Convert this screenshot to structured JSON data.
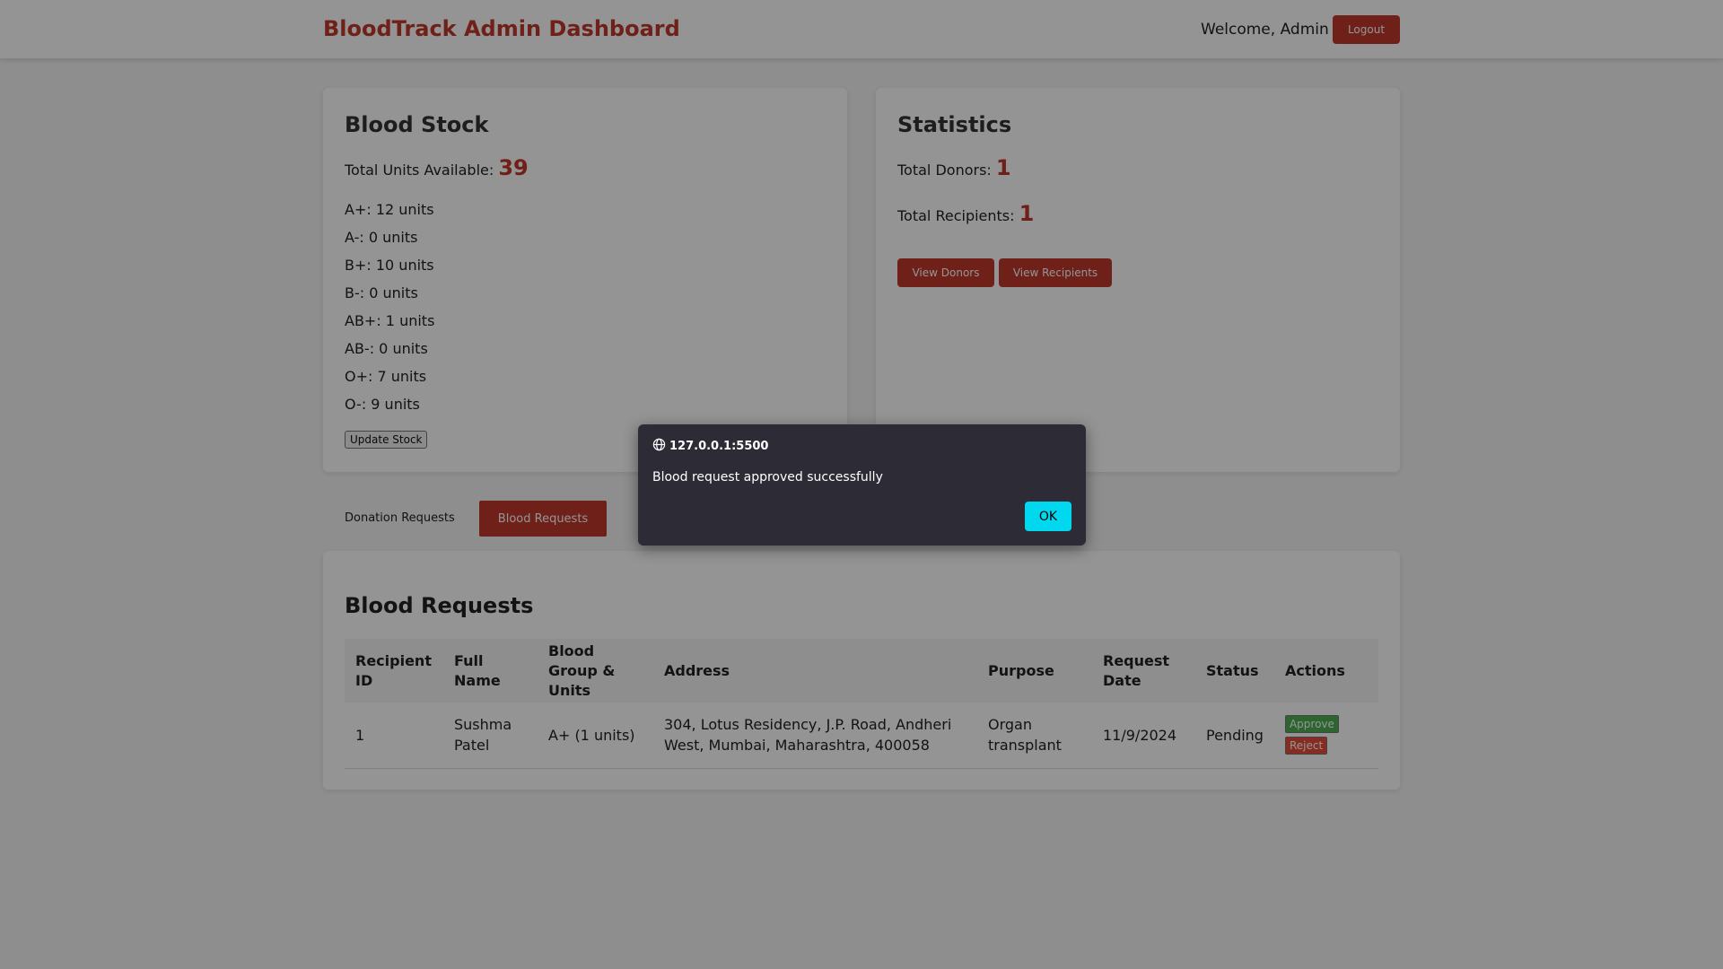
{
  "header": {
    "title": "BloodTrack Admin Dashboard",
    "welcome": "Welcome, Admin",
    "logout_label": "Logout"
  },
  "stock": {
    "heading": "Blood Stock",
    "total_label": "Total Units Available: ",
    "total_value": "39",
    "items": [
      "A+: 12 units",
      "A-: 0 units",
      "B+: 10 units",
      "B-: 0 units",
      "AB+: 1 units",
      "AB-: 0 units",
      "O+: 7 units",
      "O-: 9 units"
    ],
    "update_label": "Update Stock"
  },
  "stats": {
    "heading": "Statistics",
    "donors_label": "Total Donors: ",
    "donors_value": "1",
    "recipients_label": "Total Recipients: ",
    "recipients_value": "1",
    "view_donors_label": "View Donors",
    "view_recipients_label": "View Recipients"
  },
  "tabs": {
    "donation": "Donation Requests",
    "blood": "Blood Requests"
  },
  "requests": {
    "heading": "Blood Requests",
    "columns": [
      "Recipient ID",
      "Full Name",
      "Blood Group & Units",
      "Address",
      "Purpose",
      "Request Date",
      "Status",
      "Actions"
    ],
    "rows": [
      {
        "id": "1",
        "name": "Sushma Patel",
        "group": "A+ (1 units)",
        "address": "304, Lotus Residency, J.P. Road, Andheri West, Mumbai, Maharashtra, 400058",
        "purpose": "Organ transplant",
        "date": "11/9/2024",
        "status": "Pending",
        "approve_label": "Approve",
        "reject_label": "Reject"
      }
    ]
  },
  "dialog": {
    "origin": "127.0.0.1:5500",
    "message": "Blood request approved successfully",
    "ok_label": "OK"
  },
  "colors": {
    "brand": "#c0392b",
    "approve": "#4caf50",
    "reject": "#e74c3c",
    "dialog_bg": "#2c2b36",
    "ok_button": "#00d8f0"
  }
}
